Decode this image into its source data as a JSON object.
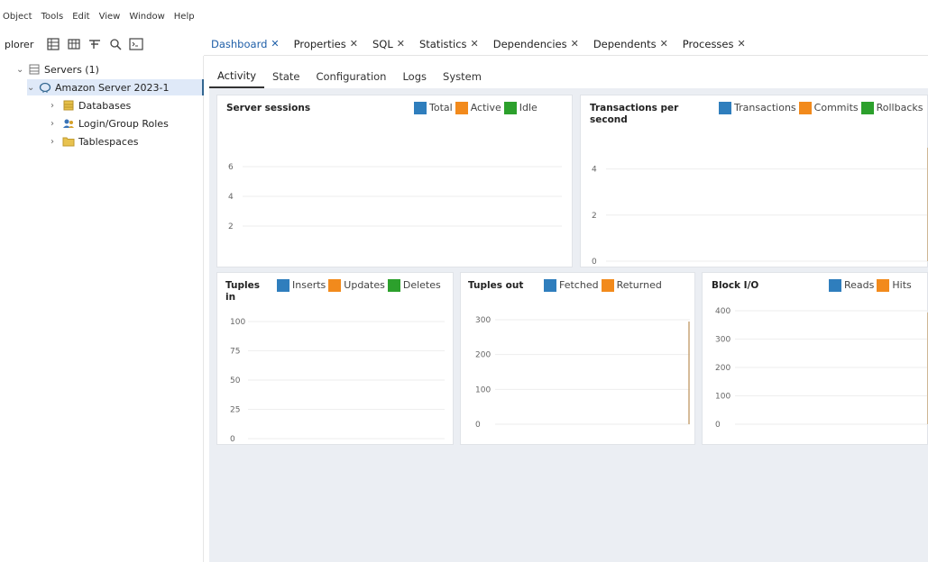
{
  "menu": [
    "Object",
    "Tools",
    "Edit",
    "View",
    "Window",
    "Help"
  ],
  "explorer": {
    "label": "plorer",
    "tools": [
      "database-icon",
      "table-icon",
      "filter-icon",
      "search-icon",
      "terminal-icon"
    ]
  },
  "tree": {
    "servers": "Servers (1)",
    "server": "Amazon Server 2023-1",
    "databases": "Databases",
    "roles": "Login/Group Roles",
    "tablespaces": "Tablespaces"
  },
  "tabs": [
    {
      "label": "Dashboard"
    },
    {
      "label": "Properties"
    },
    {
      "label": "SQL"
    },
    {
      "label": "Statistics"
    },
    {
      "label": "Dependencies"
    },
    {
      "label": "Dependents"
    },
    {
      "label": "Processes"
    }
  ],
  "subtabs": [
    "Activity",
    "State",
    "Configuration",
    "Logs",
    "System"
  ],
  "colors": {
    "blue": "#2f7ebd",
    "orange": "#f28a1c",
    "green": "#2ca02c",
    "tan": "#c9a678"
  },
  "cards": {
    "sessions": {
      "title": "Server sessions",
      "legend": [
        "Total",
        "Active",
        "Idle"
      ]
    },
    "transactions": {
      "title_1": "Transactions per",
      "title_2": "second",
      "legend": [
        "Transactions",
        "Commits",
        "Rollbacks"
      ]
    },
    "tuples_in": {
      "title_1": "Tuples",
      "title_2": "in",
      "legend": [
        "Inserts",
        "Updates",
        "Deletes"
      ]
    },
    "tuples_out": {
      "title": "Tuples out",
      "legend": [
        "Fetched",
        "Returned"
      ]
    },
    "block_io": {
      "title": "Block I/O",
      "legend": [
        "Reads",
        "Hits"
      ]
    }
  },
  "chart_data": [
    {
      "type": "line",
      "title": "Server sessions",
      "ylim": [
        0,
        8
      ],
      "yticks": [
        2,
        4,
        6
      ],
      "series": [
        {
          "name": "Total",
          "values": []
        },
        {
          "name": "Active",
          "values": []
        },
        {
          "name": "Idle",
          "values": []
        }
      ]
    },
    {
      "type": "line",
      "title": "Transactions per second",
      "ylim": [
        0,
        5
      ],
      "yticks": [
        0,
        2,
        4
      ],
      "series": [
        {
          "name": "Transactions",
          "values": []
        },
        {
          "name": "Commits",
          "values": []
        },
        {
          "name": "Rollbacks",
          "values": []
        }
      ]
    },
    {
      "type": "line",
      "title": "Tuples in",
      "ylim": [
        0,
        100
      ],
      "yticks": [
        0,
        25,
        50,
        75,
        100
      ],
      "series": [
        {
          "name": "Inserts",
          "values": []
        },
        {
          "name": "Updates",
          "values": []
        },
        {
          "name": "Deletes",
          "values": []
        }
      ]
    },
    {
      "type": "line",
      "title": "Tuples out",
      "ylim": [
        0,
        300
      ],
      "yticks": [
        0,
        100,
        200,
        300
      ],
      "series": [
        {
          "name": "Fetched",
          "values": []
        },
        {
          "name": "Returned",
          "values": []
        }
      ]
    },
    {
      "type": "line",
      "title": "Block I/O",
      "ylim": [
        0,
        400
      ],
      "yticks": [
        0,
        100,
        200,
        300,
        400
      ],
      "series": [
        {
          "name": "Reads",
          "values": []
        },
        {
          "name": "Hits",
          "values": []
        }
      ]
    }
  ]
}
